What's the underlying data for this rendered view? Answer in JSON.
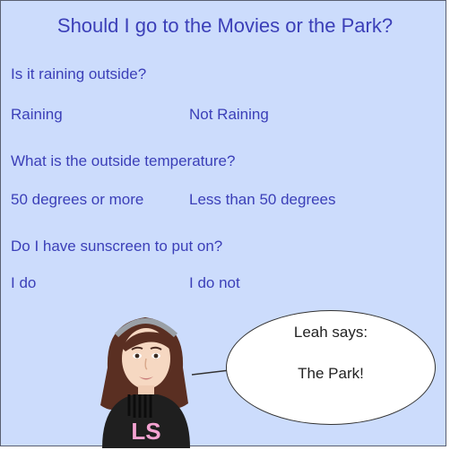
{
  "title": "Should I go to the Movies or the Park?",
  "questions": [
    {
      "text": "Is it raining outside?",
      "options": [
        "Raining",
        "Not Raining"
      ]
    },
    {
      "text": "What is the outside temperature?",
      "options": [
        "50 degrees or more",
        "Less than 50 degrees"
      ]
    },
    {
      "text": "Do I have sunscreen to put on?",
      "options": [
        "I do",
        "I do not"
      ]
    }
  ],
  "speech": {
    "speaker": "Leah says:",
    "message": "The Park!"
  },
  "avatar": {
    "initials": "LS"
  },
  "colors": {
    "background": "#ccdcfc",
    "text": "#3b3fb8",
    "initials": "#f5a3d2"
  }
}
